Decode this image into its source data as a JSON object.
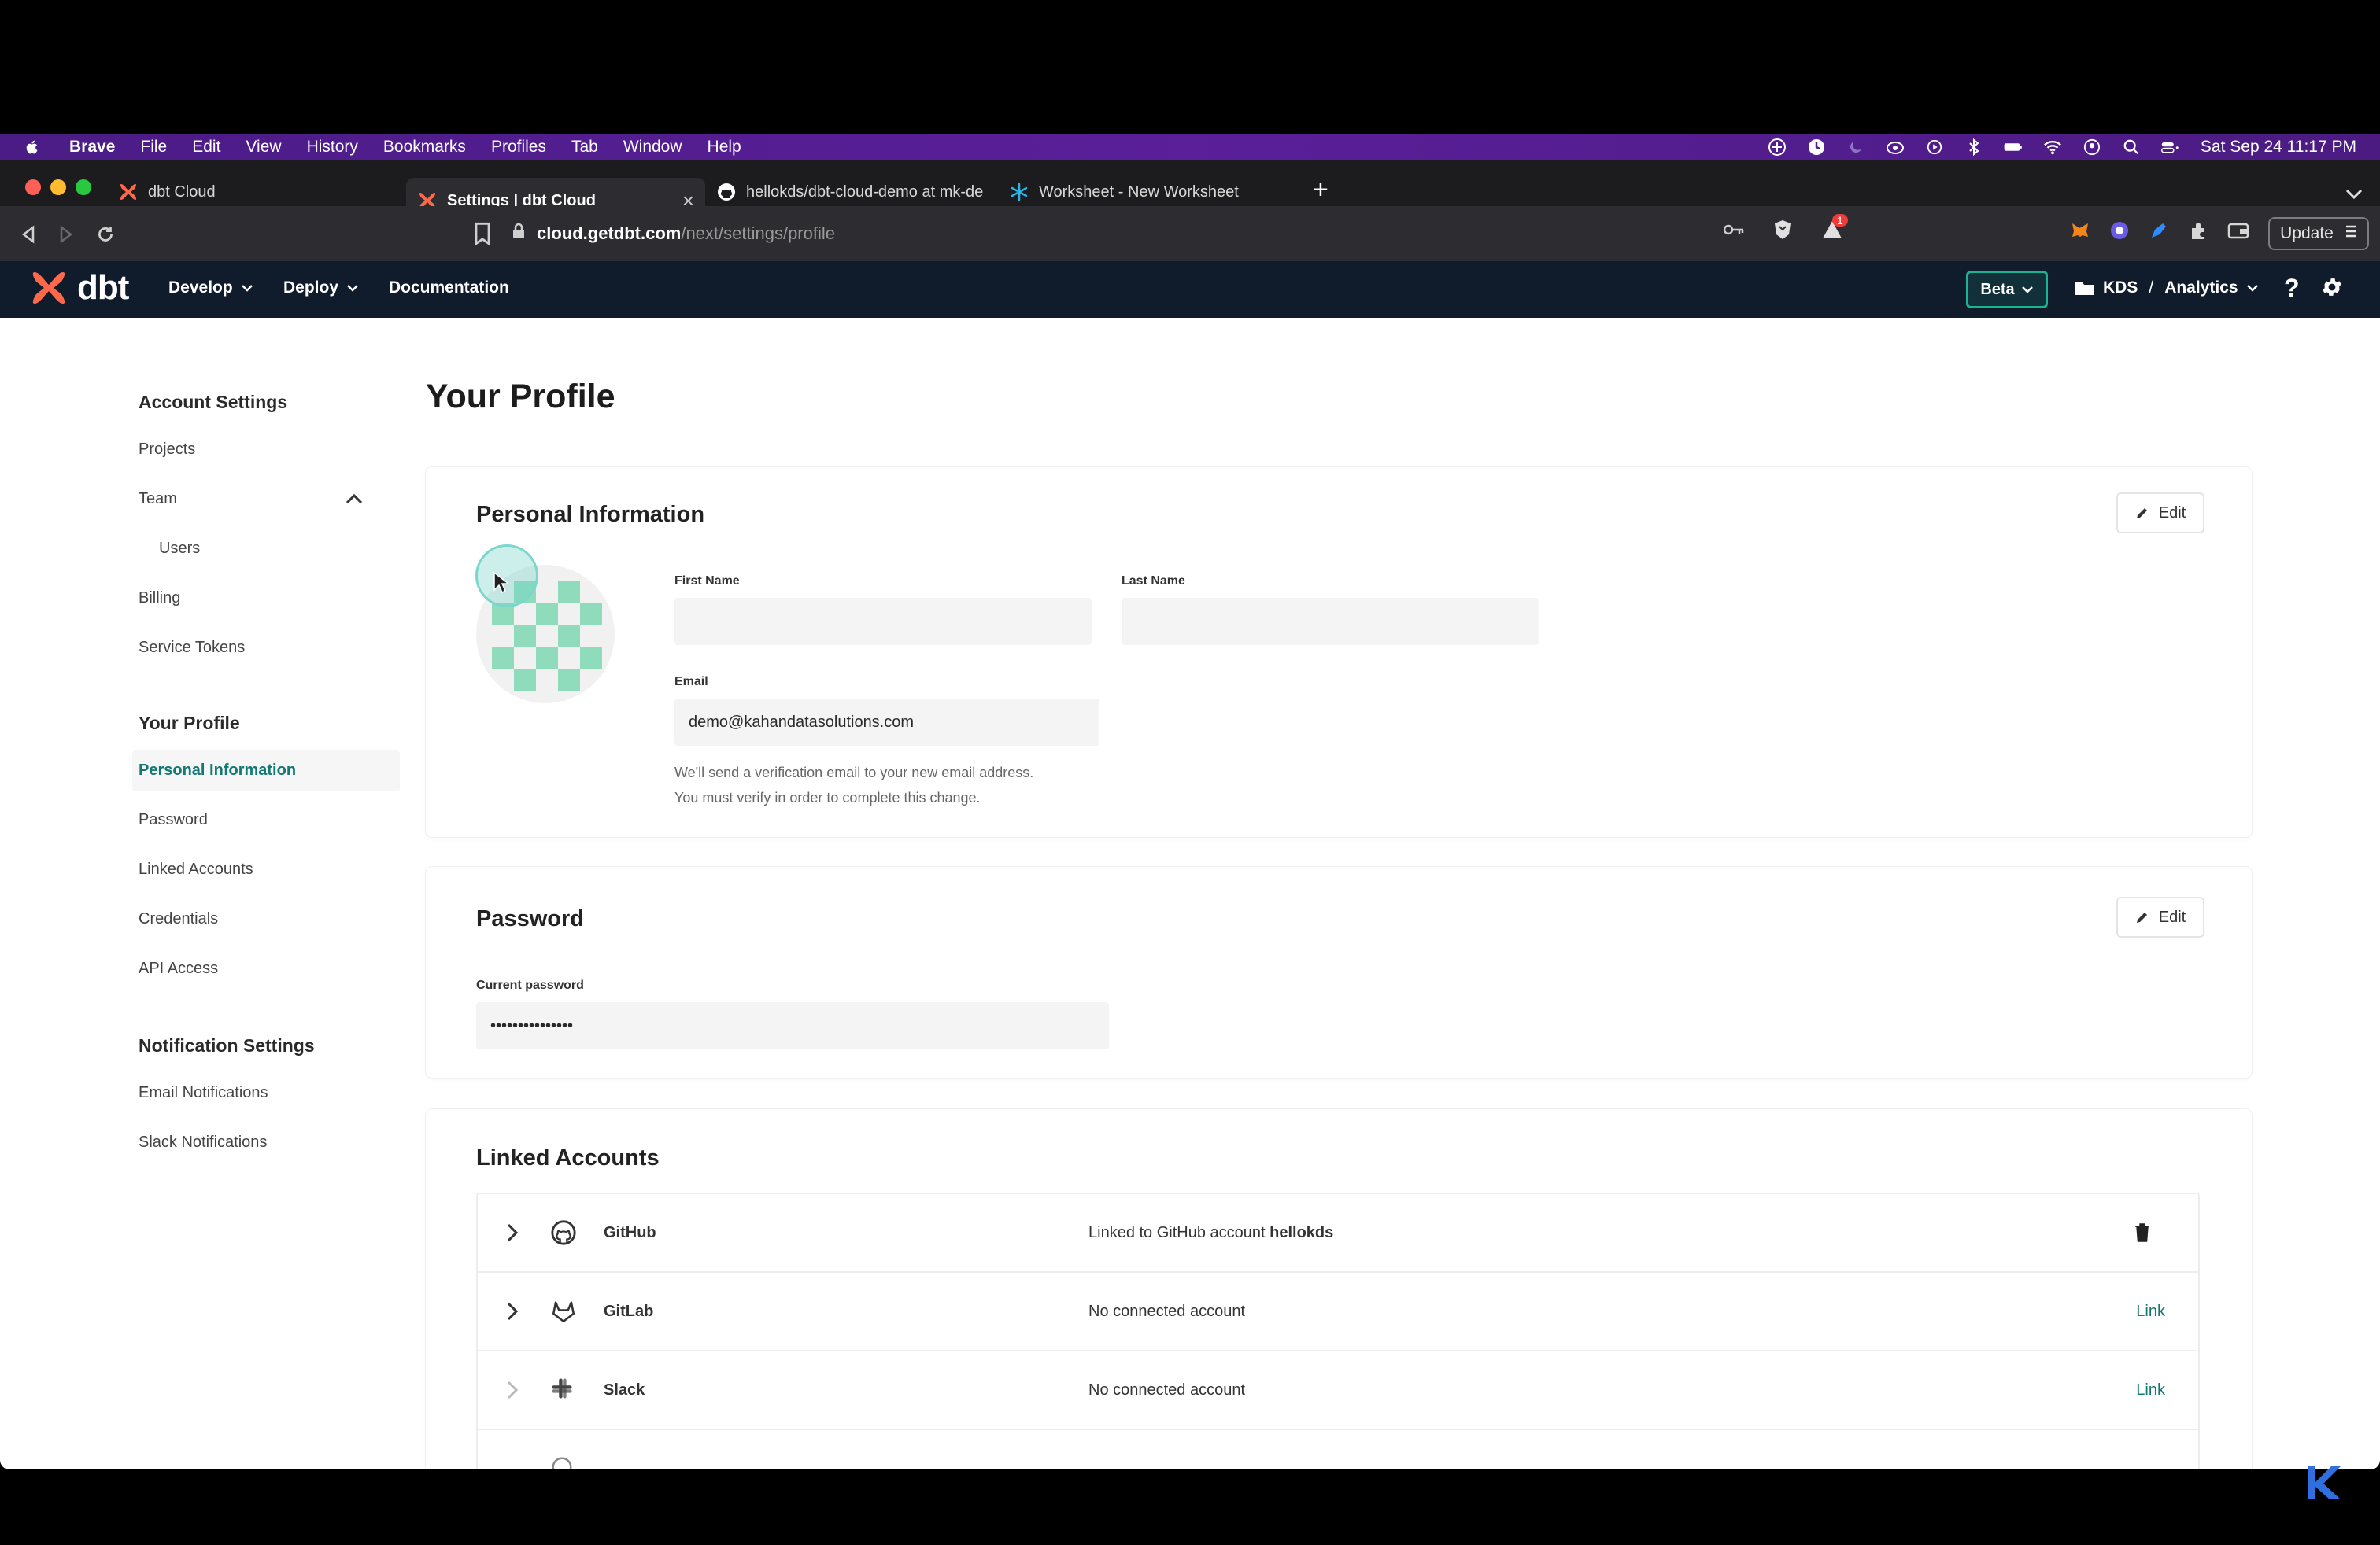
{
  "menubar": {
    "app_name": "Brave",
    "items": [
      "File",
      "Edit",
      "View",
      "History",
      "Bookmarks",
      "Profiles",
      "Tab",
      "Window",
      "Help"
    ],
    "clock": "Sat Sep 24  11:17 PM"
  },
  "tabs": [
    {
      "title": "dbt Cloud",
      "icon": "dbt-logo-icon"
    },
    {
      "title": "Settings | dbt Cloud",
      "icon": "dbt-logo-icon",
      "close": "×"
    },
    {
      "title": "hellokds/dbt-cloud-demo at mk-de",
      "icon": "github-icon"
    },
    {
      "title": "Worksheet - New Worksheet",
      "icon": "snowflake-icon"
    }
  ],
  "newtab": "+",
  "address": {
    "host": "cloud.getdbt.com",
    "path": "/next/settings/profile",
    "update_label": "Update",
    "notification_count": "1"
  },
  "dbtnav": {
    "logo_text": "dbt",
    "develop": "Develop",
    "deploy": "Deploy",
    "documentation": "Documentation",
    "beta": "Beta",
    "account": "KDS",
    "separator": "/",
    "project": "Analytics",
    "help": "?"
  },
  "sidebar": {
    "account_settings": "Account Settings",
    "projects": "Projects",
    "team": "Team",
    "users": "Users",
    "billing": "Billing",
    "service_tokens": "Service Tokens",
    "your_profile": "Your Profile",
    "personal_information": "Personal Information",
    "password": "Password",
    "linked_accounts": "Linked Accounts",
    "credentials": "Credentials",
    "api_access": "API Access",
    "notification_settings": "Notification Settings",
    "email_notifications": "Email Notifications",
    "slack_notifications": "Slack Notifications"
  },
  "page": {
    "title": "Your Profile"
  },
  "personal_info": {
    "title": "Personal Information",
    "edit": "Edit",
    "first_name_label": "First Name",
    "first_name_value": "",
    "last_name_label": "Last Name",
    "last_name_value": "",
    "email_label": "Email",
    "email_value": "demo@kahandatasolutions.com",
    "help_line1": "We'll send a verification email to your new email address.",
    "help_line2": "You must verify in order to complete this change."
  },
  "password": {
    "title": "Password",
    "edit": "Edit",
    "current_label": "Current password",
    "current_value": "•••••••••••••••"
  },
  "linked_accounts": {
    "title": "Linked Accounts",
    "rows": [
      {
        "provider": "GitHub",
        "status_prefix": "Linked to GitHub account ",
        "status_account": "hellokds",
        "action": "delete"
      },
      {
        "provider": "GitLab",
        "status_prefix": "No connected account",
        "status_account": "",
        "action": "Link"
      },
      {
        "provider": "Slack",
        "status_prefix": "No connected account",
        "status_account": "",
        "action": "Link"
      }
    ]
  },
  "colors": {
    "accent": "#127a72",
    "nav_bg": "#101b2b",
    "menubar": "#4b1c86",
    "beta_border": "#1ab394",
    "dbt_orange": "#ff694a"
  }
}
